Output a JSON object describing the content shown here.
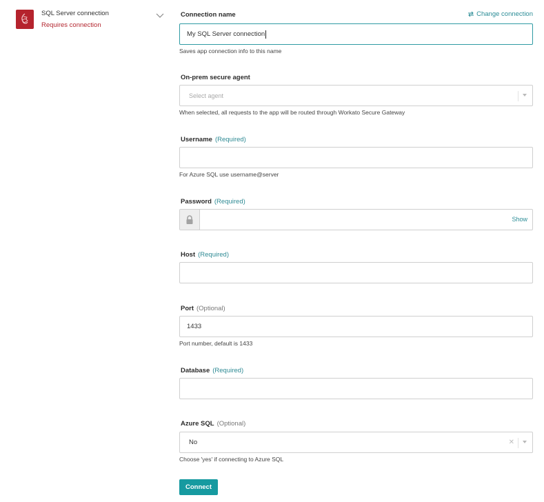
{
  "app": {
    "name": "SQL Server connection",
    "status": "Requires connection"
  },
  "header": {
    "change_connection": "Change connection"
  },
  "fields": {
    "connection_name": {
      "label": "Connection name",
      "value": "My SQL Server connection",
      "hint": "Saves app connection info to this name"
    },
    "agent": {
      "label": "On-prem secure agent",
      "placeholder": "Select agent",
      "hint": "When selected, all requests to the app will be routed through Workato Secure Gateway"
    },
    "username": {
      "label": "Username",
      "tag": "(Required)",
      "value": "",
      "hint": "For Azure SQL use username@server"
    },
    "password": {
      "label": "Password",
      "tag": "(Required)",
      "value": "",
      "show_label": "Show"
    },
    "host": {
      "label": "Host",
      "tag": "(Required)",
      "value": ""
    },
    "port": {
      "label": "Port",
      "tag": "(Optional)",
      "value": "1433",
      "hint": "Port number, default is 1433"
    },
    "database": {
      "label": "Database",
      "tag": "(Required)",
      "value": ""
    },
    "azure_sql": {
      "label": "Azure SQL",
      "tag": "(Optional)",
      "value": "No",
      "hint": "Choose 'yes' if connecting to Azure SQL"
    }
  },
  "actions": {
    "connect_label": "Connect"
  },
  "colors": {
    "accent": "#169aa0",
    "link": "#2b8c96",
    "error": "#b3262f",
    "logo_bg": "#b5232d"
  }
}
